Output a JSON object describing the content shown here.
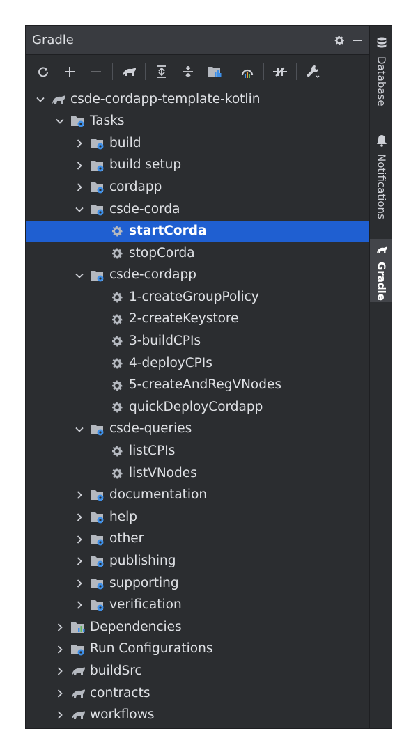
{
  "panel": {
    "title": "Gradle"
  },
  "toolbar": {
    "items": [
      {
        "name": "reload-icon",
        "glyph": "⟳"
      },
      {
        "name": "add-icon",
        "glyph": "+"
      },
      {
        "name": "remove-icon",
        "glyph": "−"
      },
      {
        "name": "elephant-icon",
        "glyph": ""
      },
      {
        "name": "expand-all-icon",
        "glyph": ""
      },
      {
        "name": "collapse-all-icon",
        "glyph": ""
      },
      {
        "name": "dependencies-icon",
        "glyph": ""
      },
      {
        "name": "analyze-icon",
        "glyph": ""
      },
      {
        "name": "toggle-offline-icon",
        "glyph": ""
      },
      {
        "name": "settings-wrench-icon",
        "glyph": ""
      }
    ]
  },
  "tree": [
    {
      "label": "csde-cordapp-template-kotlin",
      "depth": 0,
      "chevron": "down",
      "icon": "elephant"
    },
    {
      "label": "Tasks",
      "depth": 1,
      "chevron": "down",
      "icon": "folder-gear"
    },
    {
      "label": "build",
      "depth": 2,
      "chevron": "right",
      "icon": "folder-gear"
    },
    {
      "label": "build setup",
      "depth": 2,
      "chevron": "right",
      "icon": "folder-gear"
    },
    {
      "label": "cordapp",
      "depth": 2,
      "chevron": "right",
      "icon": "folder-gear"
    },
    {
      "label": "csde-corda",
      "depth": 2,
      "chevron": "down",
      "icon": "folder-gear"
    },
    {
      "label": "startCorda",
      "depth": 3,
      "chevron": "none",
      "icon": "gear",
      "selected": true
    },
    {
      "label": "stopCorda",
      "depth": 3,
      "chevron": "none",
      "icon": "gear"
    },
    {
      "label": "csde-cordapp",
      "depth": 2,
      "chevron": "down",
      "icon": "folder-gear"
    },
    {
      "label": "1-createGroupPolicy",
      "depth": 3,
      "chevron": "none",
      "icon": "gear"
    },
    {
      "label": "2-createKeystore",
      "depth": 3,
      "chevron": "none",
      "icon": "gear"
    },
    {
      "label": "3-buildCPIs",
      "depth": 3,
      "chevron": "none",
      "icon": "gear"
    },
    {
      "label": "4-deployCPIs",
      "depth": 3,
      "chevron": "none",
      "icon": "gear"
    },
    {
      "label": "5-createAndRegVNodes",
      "depth": 3,
      "chevron": "none",
      "icon": "gear"
    },
    {
      "label": "quickDeployCordapp",
      "depth": 3,
      "chevron": "none",
      "icon": "gear"
    },
    {
      "label": "csde-queries",
      "depth": 2,
      "chevron": "down",
      "icon": "folder-gear"
    },
    {
      "label": "listCPIs",
      "depth": 3,
      "chevron": "none",
      "icon": "gear"
    },
    {
      "label": "listVNodes",
      "depth": 3,
      "chevron": "none",
      "icon": "gear"
    },
    {
      "label": "documentation",
      "depth": 2,
      "chevron": "right",
      "icon": "folder-gear"
    },
    {
      "label": "help",
      "depth": 2,
      "chevron": "right",
      "icon": "folder-gear"
    },
    {
      "label": "other",
      "depth": 2,
      "chevron": "right",
      "icon": "folder-gear"
    },
    {
      "label": "publishing",
      "depth": 2,
      "chevron": "right",
      "icon": "folder-gear"
    },
    {
      "label": "supporting",
      "depth": 2,
      "chevron": "right",
      "icon": "folder-gear"
    },
    {
      "label": "verification",
      "depth": 2,
      "chevron": "right",
      "icon": "folder-gear"
    },
    {
      "label": "Dependencies",
      "depth": 1,
      "chevron": "right",
      "icon": "folder-chart"
    },
    {
      "label": "Run Configurations",
      "depth": 1,
      "chevron": "right",
      "icon": "folder-gear"
    },
    {
      "label": "buildSrc",
      "depth": 1,
      "chevron": "right",
      "icon": "elephant"
    },
    {
      "label": "contracts",
      "depth": 1,
      "chevron": "right",
      "icon": "elephant"
    },
    {
      "label": "workflows",
      "depth": 1,
      "chevron": "right",
      "icon": "elephant"
    }
  ],
  "sidebar": {
    "tabs": [
      {
        "label": "Database",
        "icon": "database-icon",
        "active": false
      },
      {
        "label": "Notifications",
        "icon": "bell-icon",
        "active": false
      },
      {
        "label": "Gradle",
        "icon": "elephant-icon",
        "active": true
      }
    ]
  },
  "colors": {
    "panel_bg": "#2b2d30",
    "selection": "#1f5fd1",
    "text": "#dfe1e5",
    "folder": "#b4b8bf",
    "gear_badge": "#3d8fe8"
  }
}
